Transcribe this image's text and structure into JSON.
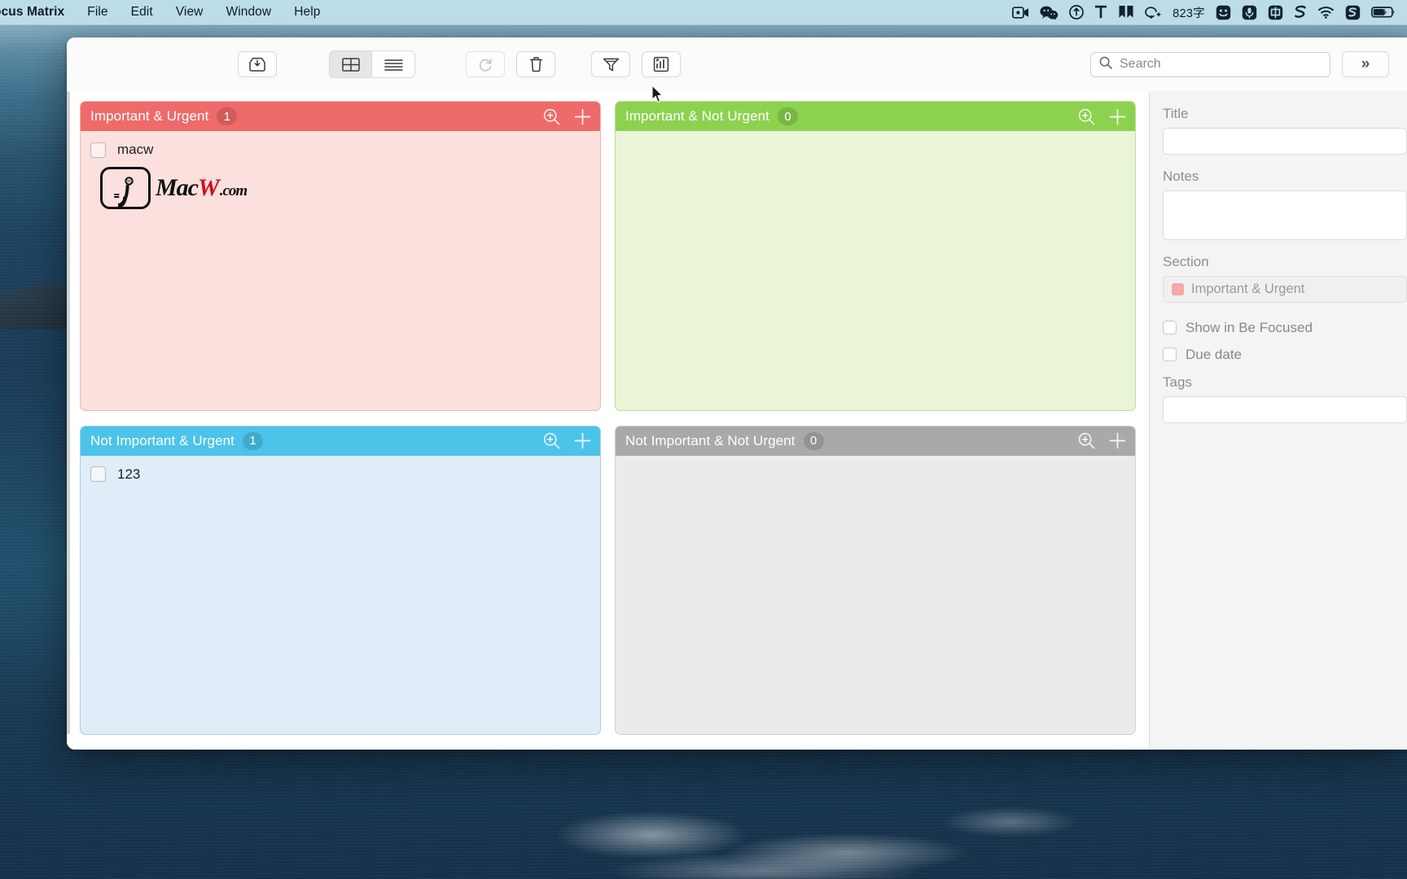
{
  "menubar": {
    "app_name": "ocus Matrix",
    "items": [
      "File",
      "Edit",
      "View",
      "Window",
      "Help"
    ],
    "tray": [
      {
        "name": "screen-record-icon",
        "glyph": "video"
      },
      {
        "name": "wechat-icon",
        "glyph": "wechat"
      },
      {
        "name": "airdrop-icon",
        "glyph": "airdrop"
      },
      {
        "name": "text-tool-icon",
        "glyph": "T"
      },
      {
        "name": "bookmark-icon",
        "glyph": "bookmark"
      },
      {
        "name": "chat-sparkle-icon",
        "glyph": "chat"
      },
      {
        "name": "word-count-indicator",
        "glyph": "text",
        "label": "823字"
      },
      {
        "name": "emoji-icon",
        "glyph": "emoji"
      },
      {
        "name": "microphone-icon",
        "glyph": "mic"
      },
      {
        "name": "input-source-chinese-icon",
        "glyph": "zhong",
        "label": "中"
      },
      {
        "name": "snipaste-icon",
        "glyph": "S"
      },
      {
        "name": "wifi-icon",
        "glyph": "wifi"
      },
      {
        "name": "sogou-icon",
        "glyph": "S2"
      },
      {
        "name": "battery-icon",
        "glyph": "battery"
      }
    ]
  },
  "toolbar": {
    "inbox_label": "Inbox",
    "grid_view_label": "Grid view",
    "list_view_label": "List view",
    "refresh_label": "Refresh",
    "delete_label": "Delete",
    "filter_label": "Filter",
    "stats_label": "Statistics",
    "expand_label": "»"
  },
  "search": {
    "placeholder": "Search",
    "value": ""
  },
  "quadrants": [
    {
      "id": "important-urgent",
      "title": "Important & Urgent",
      "count": "1",
      "header_color": "#ef6a6a",
      "body_color": "#fbe0dd",
      "tasks": [
        {
          "title": "macw",
          "checked": false,
          "attachment": "macw-logo"
        }
      ]
    },
    {
      "id": "important-not-urgent",
      "title": "Important & Not Urgent",
      "count": "0",
      "header_color": "#8cd24f",
      "body_color": "#eaf5d7",
      "tasks": []
    },
    {
      "id": "not-important-urgent",
      "title": "Not Important & Urgent",
      "count": "1",
      "header_color": "#4cc3e8",
      "body_color": "#e0edf9",
      "tasks": [
        {
          "title": "123",
          "checked": false
        }
      ]
    },
    {
      "id": "not-important-not-urgent",
      "title": "Not Important & Not Urgent",
      "count": "0",
      "header_color": "#a9a9a9",
      "body_color": "#eceaea",
      "tasks": []
    }
  ],
  "attachment_logo": {
    "brand_mac": "Mac",
    "brand_w": "W",
    "brand_tld": ".com"
  },
  "inspector": {
    "title_label": "Title",
    "title_value": "",
    "notes_label": "Notes",
    "notes_value": "",
    "section_label": "Section",
    "section_value": "Important & Urgent",
    "section_color": "#f4a8a8",
    "show_in_be_focused_label": "Show in Be Focused",
    "show_in_be_focused_checked": false,
    "due_date_label": "Due date",
    "due_date_checked": false,
    "tags_label": "Tags",
    "tags_value": ""
  }
}
